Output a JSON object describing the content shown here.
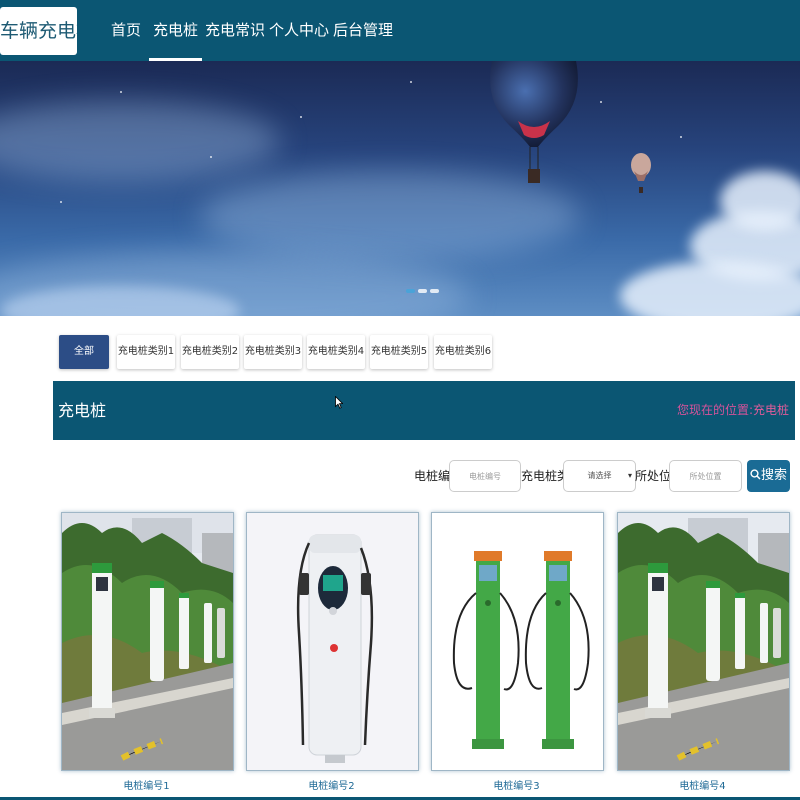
{
  "navbar": {
    "logo": "车辆充电桩",
    "items": [
      {
        "label": "首页",
        "active": false
      },
      {
        "label": "充电桩",
        "active": true
      },
      {
        "label": "充电常识",
        "active": false
      },
      {
        "label": "个人中心",
        "active": false
      },
      {
        "label": "后台管理",
        "active": false
      }
    ]
  },
  "banner": {
    "slide_count": 3,
    "active_slide": 1
  },
  "categories": [
    {
      "label": "全部",
      "active": true
    },
    {
      "label": "充电桩类别1",
      "active": false
    },
    {
      "label": "充电桩类别2",
      "active": false
    },
    {
      "label": "充电桩类别3",
      "active": false
    },
    {
      "label": "充电桩类别4",
      "active": false
    },
    {
      "label": "充电桩类别5",
      "active": false
    },
    {
      "label": "充电桩类别6",
      "active": false
    }
  ],
  "section": {
    "title": "充电桩",
    "breadcrumb_label": "您现在的位置:",
    "breadcrumb_current": "充电桩"
  },
  "search": {
    "number_label": "电桩编号",
    "number_placeholder": "电桩编号",
    "category_label": "充电桩类别",
    "category_selected": "请选择",
    "location_label": "所处位置",
    "location_placeholder": "所处位置",
    "button_label": "搜索",
    "button_icon": "search-icon"
  },
  "products": [
    {
      "name": "电桩编号1"
    },
    {
      "name": "电桩编号2"
    },
    {
      "name": "电桩编号3"
    },
    {
      "name": "电桩编号4"
    }
  ],
  "colors": {
    "primary": "#0b5673",
    "tab_active": "#2c4d86",
    "breadcrumb": "#e05c9a",
    "button": "#1a6b95",
    "card_label": "#1f6a96"
  }
}
